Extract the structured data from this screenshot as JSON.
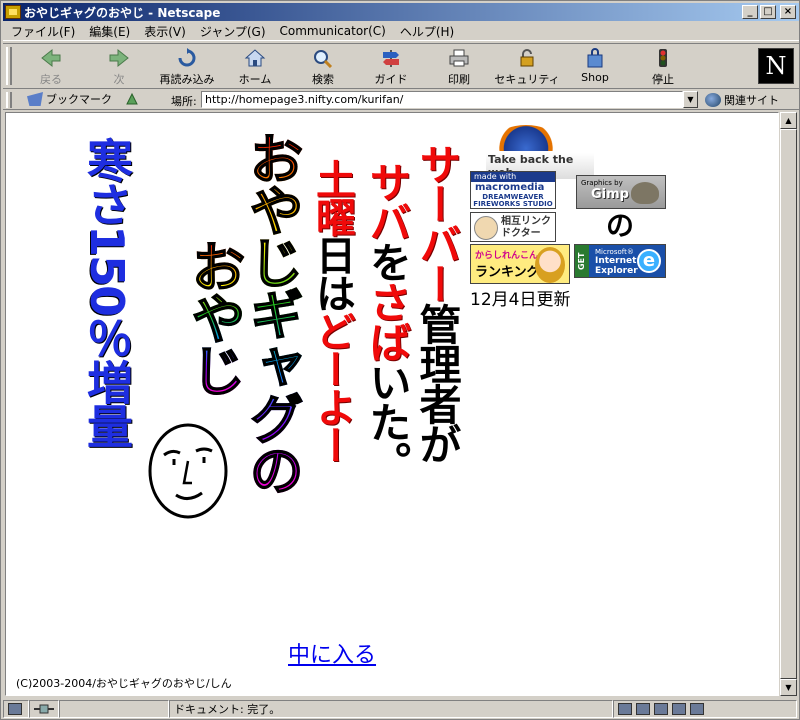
{
  "window": {
    "title": "おやじギャグのおやじ - Netscape",
    "controls": [
      "_",
      "□",
      "×"
    ]
  },
  "menu": [
    "ファイル(F)",
    "編集(E)",
    "表示(V)",
    "ジャンプ(G)",
    "Communicator(C)",
    "ヘルプ(H)"
  ],
  "toolbar": {
    "back": "戻る",
    "forward": "次",
    "reload": "再読み込み",
    "home": "ホーム",
    "search": "検索",
    "guide": "ガイド",
    "print": "印刷",
    "security": "セキュリティ",
    "shop": "Shop",
    "stop": "停止",
    "brand": "N"
  },
  "location": {
    "bookmarks": "ブックマーク",
    "label": "場所:",
    "url": "http://homepage3.nifty.com/kurifan/",
    "related": "関連サイト"
  },
  "page": {
    "cold_text": "寒さ150％増量",
    "server_line1": {
      "red": "サーバー",
      "black": "管理者が"
    },
    "server_line2": {
      "red1": "サバ",
      "black1": "を",
      "red2": "さば",
      "black2": "いた。"
    },
    "saturday": {
      "red1": "土曜",
      "black1": "日は",
      "red2": "どーよー"
    },
    "oyaji_col1": "おやじギャグの",
    "oyaji_col2": "おやじ",
    "firefox_tagline": "Take back the web",
    "macromedia": {
      "made_with": "made with",
      "name": "macromedia",
      "product": "DREAMWEAVER FIREWORKS STUDIO"
    },
    "gimp": {
      "graphics_by": "Graphics by",
      "name": "Gimp"
    },
    "mutual_link": "相互リンク ドクター",
    "no_char": "の",
    "ranking": {
      "top": "からしれんこん",
      "main": "ランキング"
    },
    "ie": {
      "get": "GET",
      "ms": "Microsoft®",
      "name": "Internet Explorer",
      "e": "e"
    },
    "updated": "12月4日更新",
    "enter": "中に入る",
    "copyright": "(C)2003-2004/おやじギャグのおやじ/しん"
  },
  "status": {
    "text": "ドキュメント: 完了。"
  }
}
